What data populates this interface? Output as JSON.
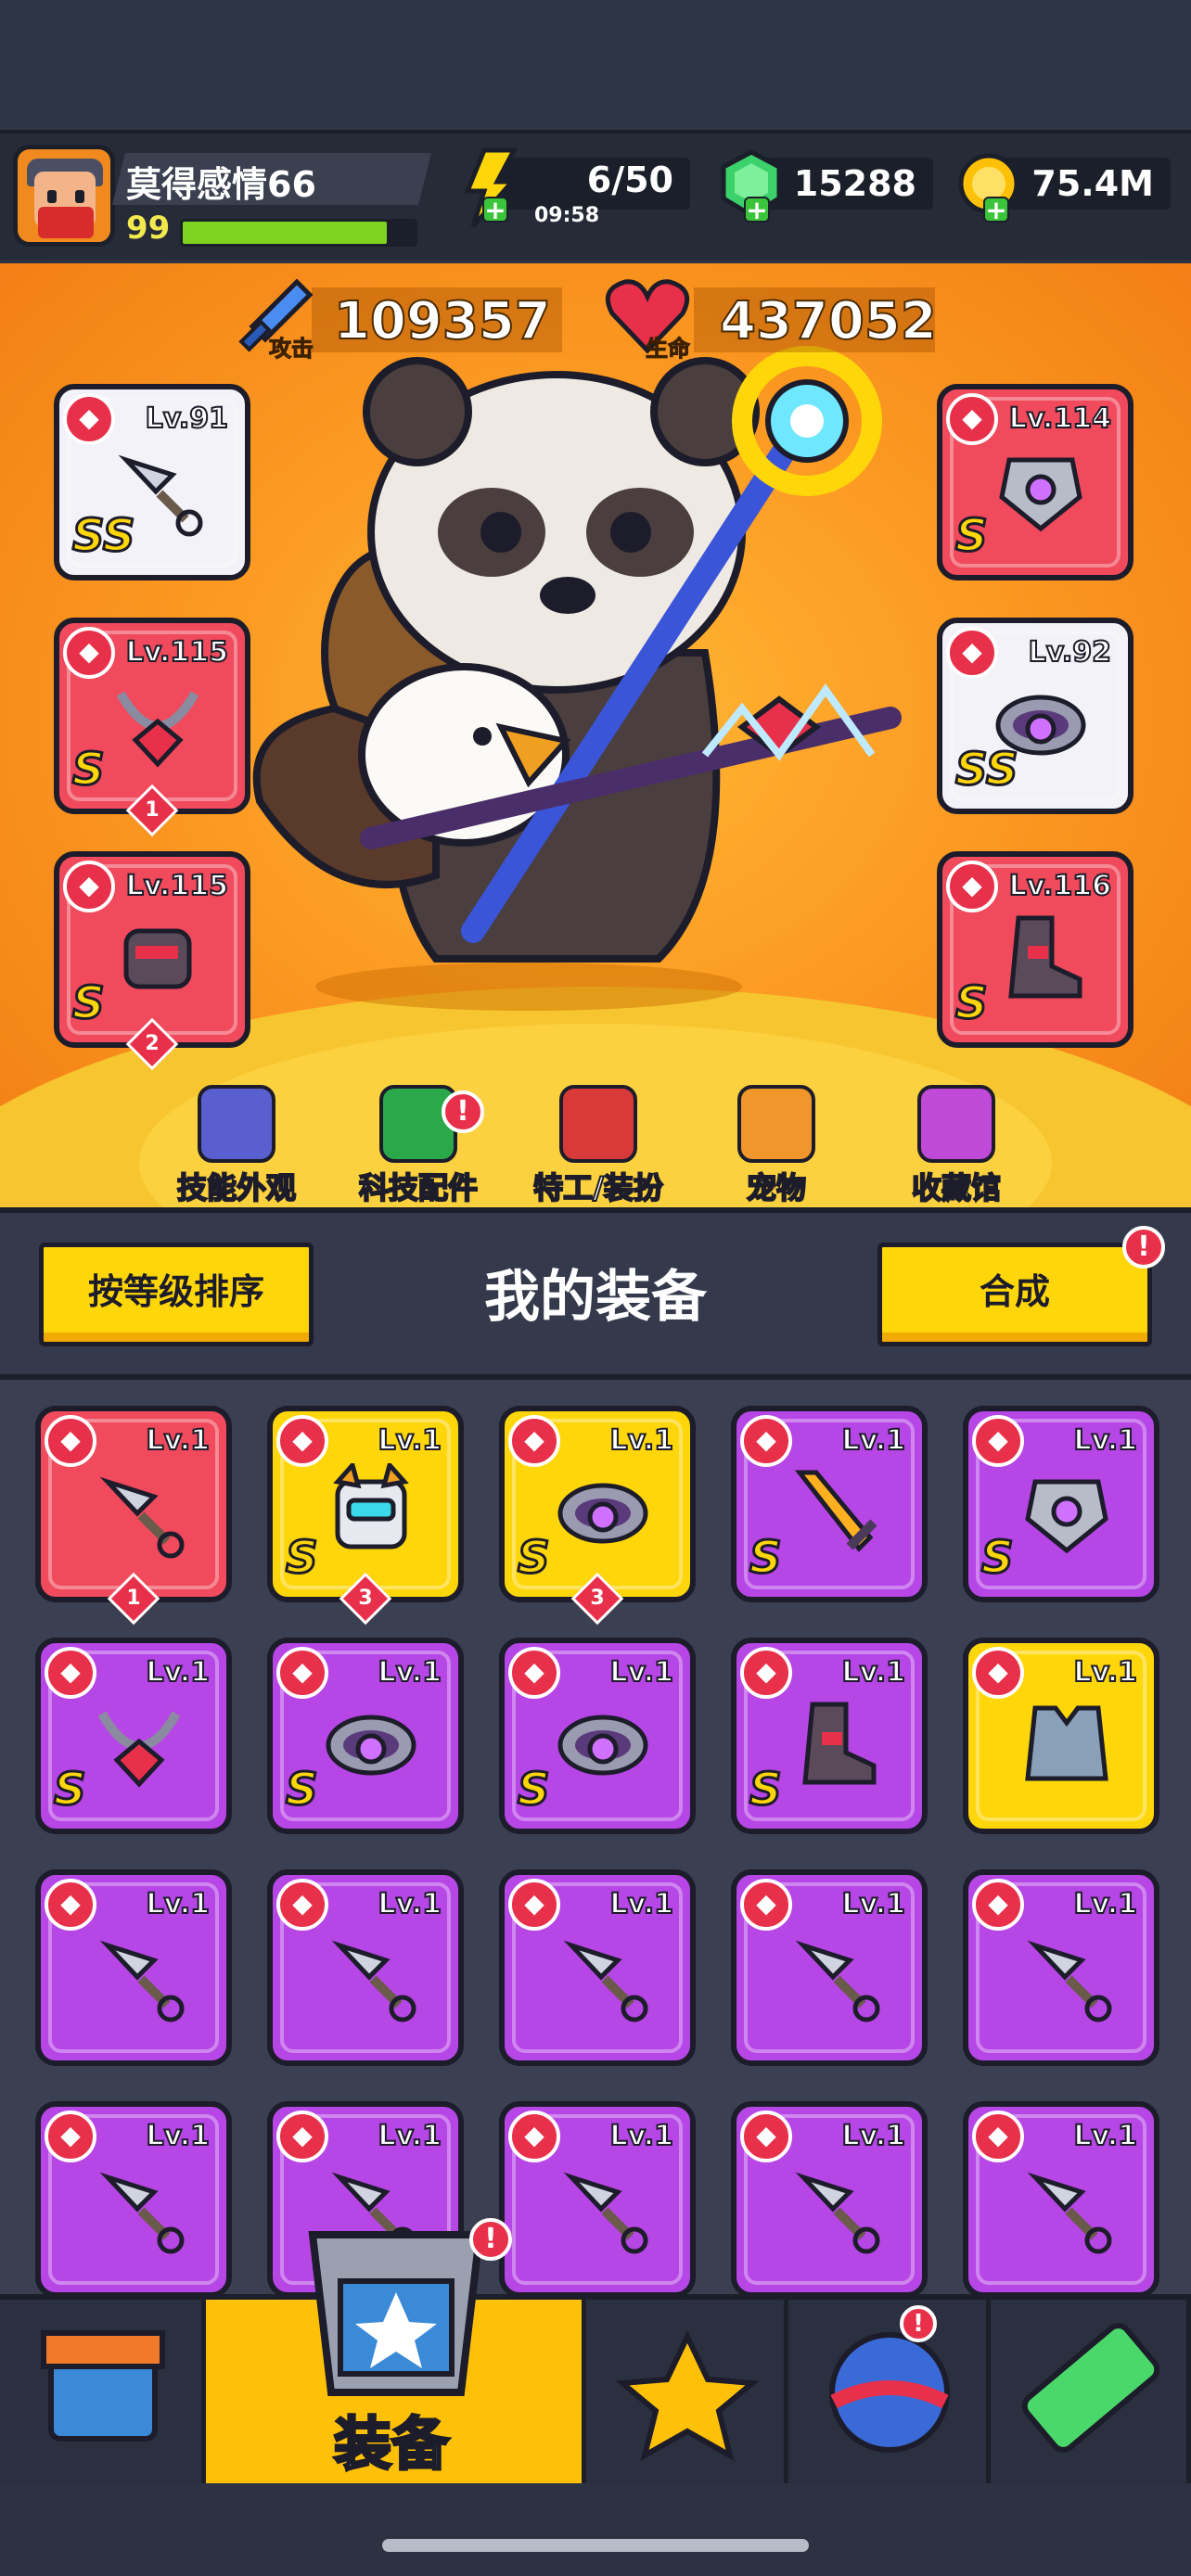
{
  "player": {
    "name": "莫得感情66",
    "level": "99",
    "xp_fraction": 0.88
  },
  "resources": {
    "energy": {
      "value": "6/50",
      "timer": "09:58",
      "icon": "lightning-icon"
    },
    "gems": {
      "value": "15288",
      "icon": "green-gem-icon"
    },
    "coins": {
      "value": "75.4M",
      "icon": "gold-coin-icon"
    }
  },
  "stats": {
    "attack": {
      "label": "攻击",
      "value": "109357"
    },
    "hp": {
      "label": "生命",
      "value": "437052"
    }
  },
  "equipped": {
    "left": [
      {
        "level": "Lv.91",
        "grade": "SS",
        "color": "white",
        "slot_icon": "weapon-slot-icon",
        "item": "gear-staff-icon"
      },
      {
        "level": "Lv.115",
        "grade": "S",
        "color": "red",
        "slot_icon": "necklace-slot-icon",
        "item": "chain-necklace-icon",
        "stars": "1"
      },
      {
        "level": "Lv.115",
        "grade": "S",
        "color": "red",
        "slot_icon": "glove-slot-icon",
        "item": "gauntlet-icon",
        "stars": "2"
      }
    ],
    "right": [
      {
        "level": "Lv.114",
        "grade": "S",
        "color": "red",
        "slot_icon": "armor-slot-icon",
        "item": "armor-icon"
      },
      {
        "level": "Lv.92",
        "grade": "SS",
        "color": "white",
        "slot_icon": "belt-slot-icon",
        "item": "belt-icon"
      },
      {
        "level": "Lv.116",
        "grade": "S",
        "color": "red",
        "slot_icon": "boot-slot-icon",
        "item": "boot-icon"
      }
    ]
  },
  "menu": [
    {
      "label": "技能外观",
      "icon": "skill-skin-icon",
      "color": "#5a5fd0"
    },
    {
      "label": "科技配件",
      "icon": "tech-part-icon",
      "color": "#2aa84a",
      "badge": "!"
    },
    {
      "label": "特工/装扮",
      "icon": "agent-outfit-icon",
      "color": "#d83a3a"
    },
    {
      "label": "宠物",
      "icon": "pet-icon",
      "color": "#f0962a"
    },
    {
      "label": "收藏馆",
      "icon": "collection-icon",
      "color": "#c04ad8"
    }
  ],
  "panel": {
    "sort_button": "按等级排序",
    "title": "我的装备",
    "merge_button": "合成",
    "merge_badge": "!"
  },
  "inventory": [
    {
      "level": "Lv.1",
      "color": "red",
      "slot_icon": "weapon-slot-icon",
      "item": "kunai-icon",
      "stars": "1"
    },
    {
      "level": "Lv.1",
      "color": "yellow",
      "grade": "S",
      "slot_icon": "armor-slot-icon",
      "item": "robot-armor-icon",
      "stars": "3"
    },
    {
      "level": "Lv.1",
      "color": "yellow",
      "grade": "S",
      "slot_icon": "belt-slot-icon",
      "item": "ring-belt-icon",
      "stars": "3"
    },
    {
      "level": "Lv.1",
      "color": "purple",
      "grade": "S",
      "slot_icon": "weapon-slot-icon",
      "item": "flame-sword-icon"
    },
    {
      "level": "Lv.1",
      "color": "purple",
      "grade": "S",
      "slot_icon": "armor-slot-icon",
      "item": "armor-icon"
    },
    {
      "level": "Lv.1",
      "color": "purple",
      "grade": "S",
      "slot_icon": "necklace-slot-icon",
      "item": "chain-necklace-icon"
    },
    {
      "level": "Lv.1",
      "color": "purple",
      "grade": "S",
      "slot_icon": "belt-slot-icon",
      "item": "hex-belt-icon"
    },
    {
      "level": "Lv.1",
      "color": "purple",
      "grade": "S",
      "slot_icon": "belt-slot-icon",
      "item": "ring-belt-icon"
    },
    {
      "level": "Lv.1",
      "color": "purple",
      "grade": "S",
      "slot_icon": "boot-slot-icon",
      "item": "boot-icon"
    },
    {
      "level": "Lv.1",
      "color": "yellow",
      "slot_icon": "armor-slot-icon",
      "item": "vest-icon"
    },
    {
      "level": "Lv.1",
      "color": "purple",
      "slot_icon": "weapon-slot-icon",
      "item": "kunai-icon"
    },
    {
      "level": "Lv.1",
      "color": "purple",
      "slot_icon": "weapon-slot-icon",
      "item": "kunai-icon"
    },
    {
      "level": "Lv.1",
      "color": "purple",
      "slot_icon": "weapon-slot-icon",
      "item": "kunai-icon"
    },
    {
      "level": "Lv.1",
      "color": "purple",
      "slot_icon": "weapon-slot-icon",
      "item": "kunai-icon"
    },
    {
      "level": "Lv.1",
      "color": "purple",
      "slot_icon": "weapon-slot-icon",
      "item": "kunai-icon"
    },
    {
      "level": "Lv.1",
      "color": "purple",
      "slot_icon": "weapon-slot-icon",
      "item": "kunai-icon"
    },
    {
      "level": "Lv.1",
      "color": "purple",
      "slot_icon": "weapon-slot-icon",
      "item": "kunai-icon"
    },
    {
      "level": "Lv.1",
      "color": "purple",
      "slot_icon": "weapon-slot-icon",
      "item": "kunai-icon"
    },
    {
      "level": "Lv.1",
      "color": "purple",
      "slot_icon": "weapon-slot-icon",
      "item": "kunai-icon"
    },
    {
      "level": "Lv.1",
      "color": "purple",
      "slot_icon": "weapon-slot-icon",
      "item": "kunai-icon"
    }
  ],
  "tabs": [
    {
      "icon": "shop-icon"
    },
    {
      "icon": "equipment-icon",
      "label": "装备",
      "active": true,
      "badge": "!"
    },
    {
      "icon": "battle-star-icon"
    },
    {
      "icon": "gacha-ball-icon",
      "badge": "!"
    },
    {
      "icon": "dna-tube-icon"
    }
  ],
  "colors": {
    "red": "#f04a5c",
    "purple": "#b746e6",
    "yellow": "#ffd60a",
    "white": "#f2f2f8",
    "accent": "#ffc107"
  }
}
